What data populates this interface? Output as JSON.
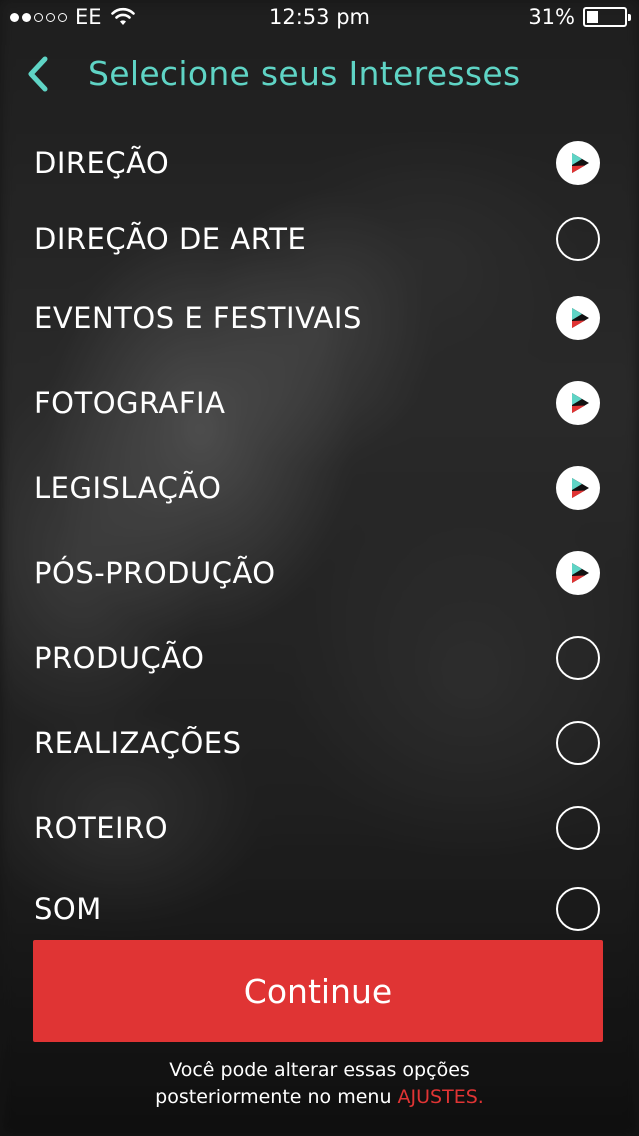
{
  "status_bar": {
    "carrier": "EE",
    "time": "12:53 pm",
    "battery": "31%",
    "battery_level": 0.31
  },
  "header": {
    "title": "Selecione seus Interesses",
    "back_icon": "chevron-left-icon",
    "accent_color": "#5fd4c5"
  },
  "interests": [
    {
      "label": "DIREÇÃO",
      "selected": true
    },
    {
      "label": "DIREÇÃO DE ARTE",
      "selected": false
    },
    {
      "label": "EVENTOS E FESTIVAIS",
      "selected": true
    },
    {
      "label": "FOTOGRAFIA",
      "selected": true
    },
    {
      "label": "LEGISLAÇÃO",
      "selected": true
    },
    {
      "label": "PÓS-PRODUÇÃO",
      "selected": true
    },
    {
      "label": "PRODUÇÃO",
      "selected": false
    },
    {
      "label": "REALIZAÇÕES",
      "selected": false
    },
    {
      "label": "ROTEIRO",
      "selected": false
    },
    {
      "label": "SOM",
      "selected": false
    }
  ],
  "continue_label": "Continue",
  "footer": {
    "line1": "Você pode alterar essas opções",
    "line2_prefix": "posteriormente no menu ",
    "link_label": "AJUSTES."
  },
  "colors": {
    "primary_button": "#e03434",
    "link": "#e03434",
    "selected_icon_red": "#e03434",
    "selected_icon_teal": "#5fd4c5"
  }
}
